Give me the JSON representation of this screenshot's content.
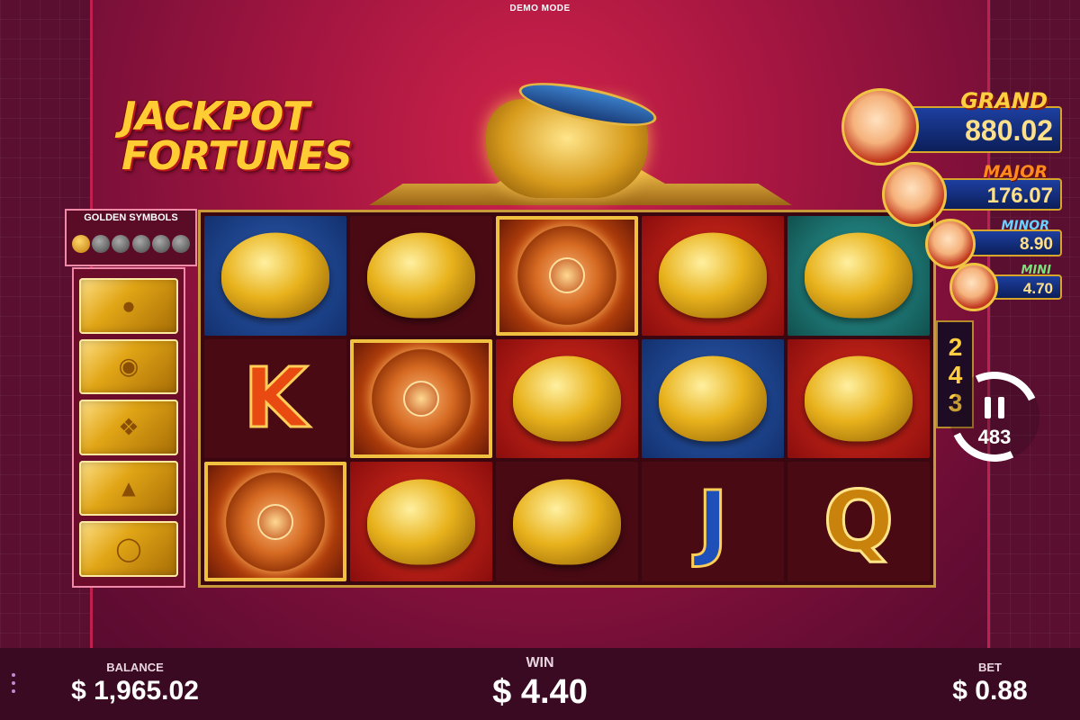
{
  "top": {
    "mode_label": "DEMO MODE"
  },
  "logo": {
    "line1": "JACKPOT",
    "line2": "FORTUNES"
  },
  "golden_symbols": {
    "title": "GOLDEN SYMBOLS",
    "icons": [
      "toad-coin-icon",
      "toad-icon",
      "turtle-icon",
      "koi-icon",
      "ingot-icon",
      "coins-icon"
    ],
    "tiles": [
      "toad-icon",
      "turtle-icon",
      "koi-icon",
      "ingot-icon",
      "coins-icon"
    ]
  },
  "reels": {
    "rows": [
      [
        {
          "symbol": "koi-fish",
          "bg": "blue"
        },
        {
          "symbol": "gold-coins",
          "bg": "dark"
        },
        {
          "symbol": "medallion",
          "bg": "coin-frame"
        },
        {
          "symbol": "money-toad",
          "bg": "red"
        },
        {
          "symbol": "gold-ingots",
          "bg": "teal"
        }
      ],
      [
        {
          "symbol": "K",
          "bg": "dark"
        },
        {
          "symbol": "medallion",
          "bg": "coin-frame"
        },
        {
          "symbol": "money-toad",
          "bg": "red"
        },
        {
          "symbol": "koi-fish",
          "bg": "blue"
        },
        {
          "symbol": "money-toad",
          "bg": "red"
        }
      ],
      [
        {
          "symbol": "medallion",
          "bg": "coin-frame"
        },
        {
          "symbol": "money-toad",
          "bg": "red"
        },
        {
          "symbol": "gold-coins",
          "bg": "dark"
        },
        {
          "symbol": "J",
          "bg": "dark"
        },
        {
          "symbol": "Q",
          "bg": "dark"
        }
      ]
    ]
  },
  "ways": {
    "value": "243"
  },
  "spin": {
    "autoplay_count": "483"
  },
  "jackpots": {
    "grand": {
      "label": "GRAND",
      "value": "880.02"
    },
    "major": {
      "label": "MAJOR",
      "value": "176.07"
    },
    "minor": {
      "label": "MINOR",
      "value": "8.90"
    },
    "mini": {
      "label": "MINI",
      "value": "4.70"
    }
  },
  "footer": {
    "balance_label": "BALANCE",
    "balance_value": "$ 1,965.02",
    "win_label": "WIN",
    "win_value": "$ 4.40",
    "bet_label": "BET",
    "bet_value": "$ 0.88"
  },
  "colors": {
    "accent_gold": "#ffcc33",
    "brand_red": "#b8141e",
    "jackpot_blue": "#1d3fa0"
  }
}
